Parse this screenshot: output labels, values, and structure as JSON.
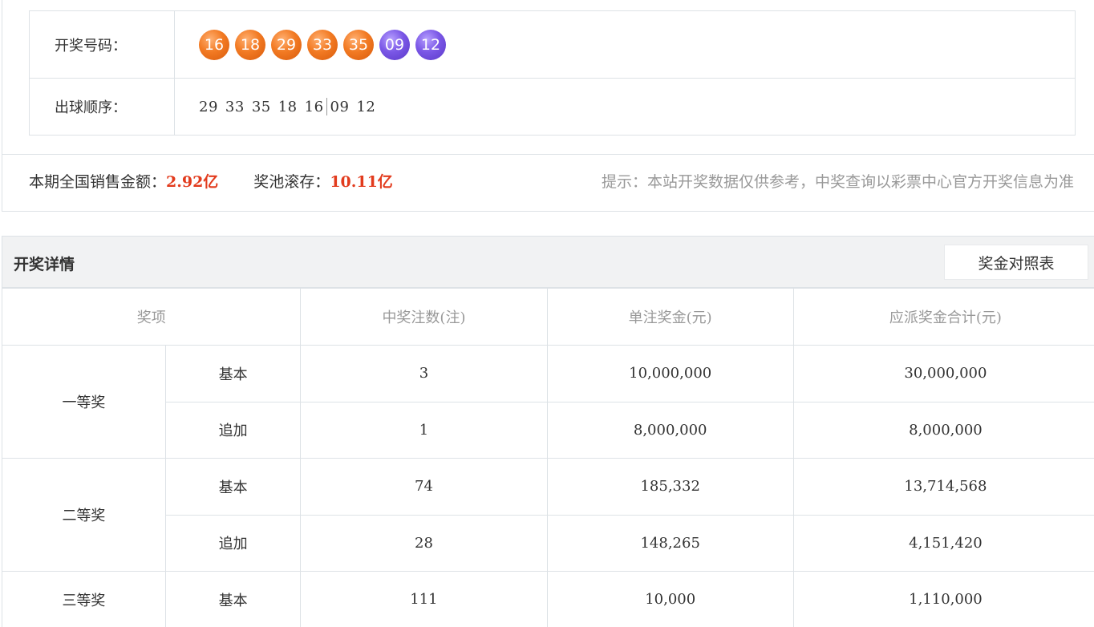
{
  "draw": {
    "numbers_label": "开奖号码：",
    "front_balls": [
      "16",
      "18",
      "29",
      "33",
      "35"
    ],
    "back_balls": [
      "09",
      "12"
    ],
    "order_label": "出球顺序：",
    "order_front": [
      "29",
      "33",
      "35",
      "18",
      "16"
    ],
    "order_back": [
      "09",
      "12"
    ],
    "colors": {
      "front": "#f27a23",
      "back": "#7a57e6"
    }
  },
  "sales": {
    "sales_label": "本期全国销售金额：",
    "sales_amount": "2.92亿",
    "pool_label": "奖池滚存：",
    "pool_amount": "10.11亿",
    "tip": "提示：本站开奖数据仅供参考，中奖查询以彩票中心官方开奖信息为准",
    "accent_color": "#e23b1d"
  },
  "detail": {
    "title": "开奖详情",
    "chart_button": "奖金对照表",
    "headers": [
      "奖项",
      "中奖注数(注)",
      "单注奖金(元)",
      "应派奖金合计(元)"
    ],
    "prizes": [
      {
        "name": "一等奖",
        "rows": [
          {
            "type": "基本",
            "count": "3",
            "single": "10,000,000",
            "total": "30,000,000"
          },
          {
            "type": "追加",
            "count": "1",
            "single": "8,000,000",
            "total": "8,000,000"
          }
        ]
      },
      {
        "name": "二等奖",
        "rows": [
          {
            "type": "基本",
            "count": "74",
            "single": "185,332",
            "total": "13,714,568"
          },
          {
            "type": "追加",
            "count": "28",
            "single": "148,265",
            "total": "4,151,420"
          }
        ]
      },
      {
        "name": "三等奖",
        "rows": [
          {
            "type": "基本",
            "count": "111",
            "single": "10,000",
            "total": "1,110,000"
          }
        ]
      }
    ]
  }
}
